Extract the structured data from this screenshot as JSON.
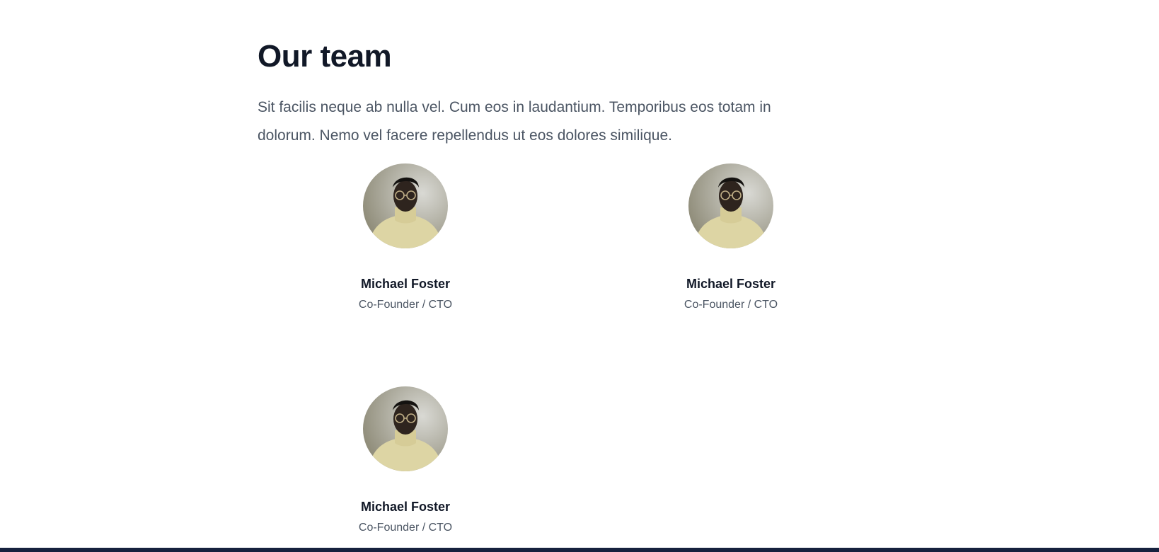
{
  "team": {
    "title": "Our team",
    "description": "Sit facilis neque ab nulla vel. Cum eos in laudantium. Temporibus eos totam in dolorum. Nemo vel facere repellendus ut eos dolores similique.",
    "members": [
      {
        "name": "Michael Foster",
        "role": "Co-Founder / CTO",
        "avatar": "portrait-photo"
      },
      {
        "name": "Michael Foster",
        "role": "Co-Founder / CTO",
        "avatar": "portrait-photo"
      },
      {
        "name": "Michael Foster",
        "role": "Co-Founder / CTO",
        "avatar": "portrait-photo"
      }
    ]
  },
  "colors": {
    "heading": "#111827",
    "body_text": "#4b5563",
    "footer": "#16213e"
  }
}
